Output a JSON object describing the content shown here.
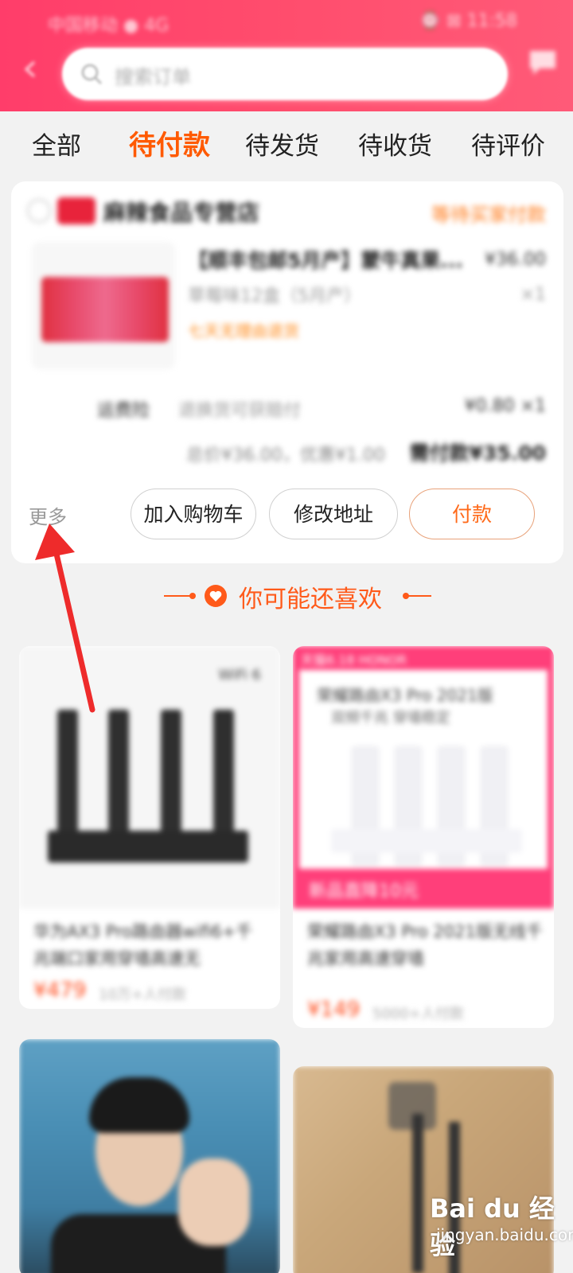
{
  "status_bar": {
    "left": "中国移动 ● 4G",
    "right": "⌚ ⊠ 11:58"
  },
  "search": {
    "placeholder": "搜索订单"
  },
  "tabs": [
    {
      "label": "全部"
    },
    {
      "label": "待付款"
    },
    {
      "label": "待发货"
    },
    {
      "label": "待收货"
    },
    {
      "label": "待评价"
    }
  ],
  "order": {
    "shop_name": "麻辣食品专营店",
    "status": "等待买家付款",
    "product_title": "【顺丰包邮5月产】蒙牛真果...",
    "product_price": "¥36.00",
    "product_spec": "草莓味12盒（5月产）",
    "product_qty": "×1",
    "product_tag": "七天无理由退货",
    "shipping_label": "运费险",
    "shipping_text": "退换货可获赔付",
    "shipping_price": "¥0.80 ×1",
    "total_text": "总价¥36.00，优惠¥1.00",
    "total_pay": "需付款¥35.00",
    "more": "更多",
    "btn_cart": "加入购物车",
    "btn_address": "修改地址",
    "btn_pay": "付款"
  },
  "recommend": {
    "title": "你可能还喜欢",
    "items": [
      {
        "wifi_tag": "WiFi 6",
        "title": "华为AX3 Pro路由器wifi6+千兆端口家用穿墙高速无",
        "price": "¥479",
        "sales": "10万+人付款"
      },
      {
        "banner_top": "天猫6.18  HONOR",
        "banner_line1": "荣耀路由X3 Pro 2021版",
        "banner_line2": "双频千兆  穿墙稳定",
        "banner_bottom": "新品直降10元",
        "title": "荣耀路由X3 Pro 2021版无线千兆家用高速穿墙",
        "price": "¥149",
        "sales": "5000+人付款"
      },
      {
        "title": ""
      },
      {
        "title": ""
      }
    ]
  },
  "watermark": {
    "logo": "Bai du 经验",
    "sub": "jingyan.baidu.com"
  },
  "colors": {
    "accent": "#ff5a00",
    "header": "#ff4d6d",
    "pay_border": "#e8a27a"
  }
}
